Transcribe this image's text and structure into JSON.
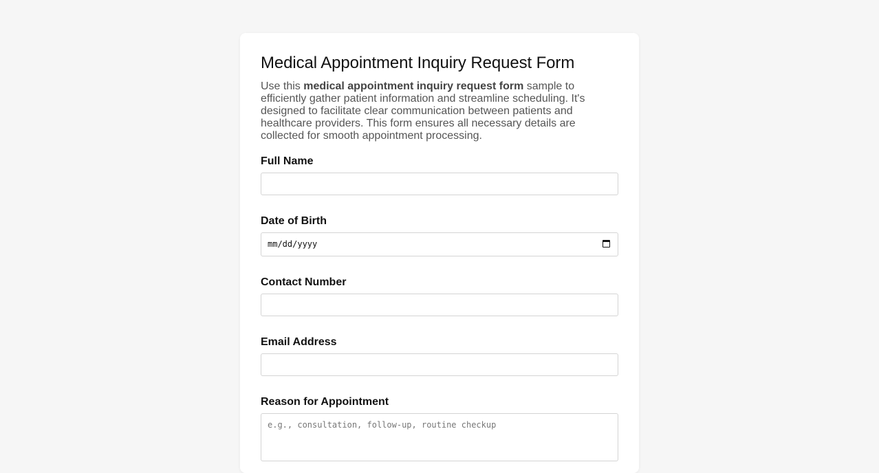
{
  "form": {
    "title": "Medical Appointment Inquiry Request Form",
    "description_prefix": "Use this ",
    "description_bold": "medical appointment inquiry request form",
    "description_suffix": " sample to efficiently gather patient information and streamline scheduling. It's designed to facilitate clear communication between patients and healthcare providers. This form ensures all necessary details are collected for smooth appointment processing.",
    "fields": {
      "full_name": {
        "label": "Full Name",
        "value": ""
      },
      "dob": {
        "label": "Date of Birth",
        "placeholder": "mm/dd/yyyy"
      },
      "contact": {
        "label": "Contact Number",
        "value": ""
      },
      "email": {
        "label": "Email Address",
        "value": ""
      },
      "reason": {
        "label": "Reason for Appointment",
        "placeholder": "e.g., consultation, follow-up, routine checkup"
      }
    }
  },
  "colors": {
    "background": "#f6f6f6",
    "card": "#ffffff",
    "border": "#d4d4d4"
  }
}
